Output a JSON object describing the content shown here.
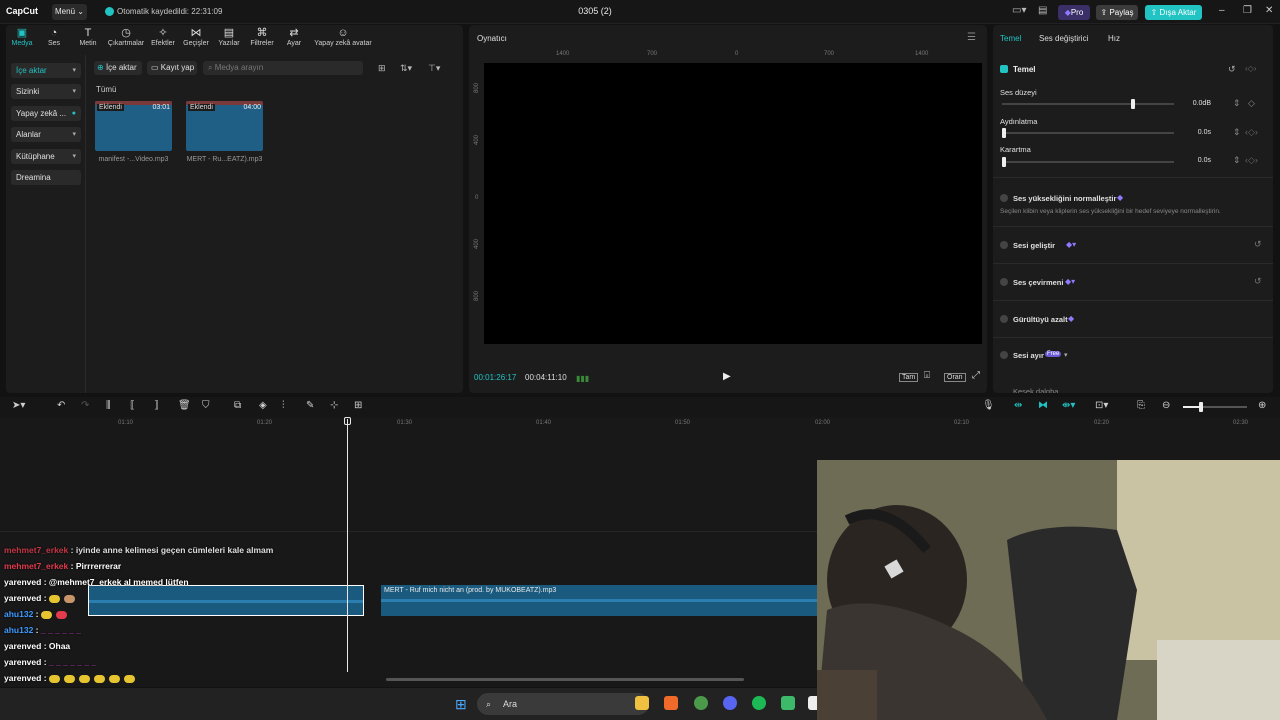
{
  "titlebar": {
    "logo": "CapCut",
    "menu_label": "Menü",
    "autosave_text": "Otomatik kaydedildi: 22:31:09",
    "project_title": "0305 (2)",
    "pro_label": "Pro",
    "share_label": "Paylaş",
    "export_label": "Dışa Aktar"
  },
  "media_panel": {
    "tabs": [
      {
        "label": "Medya",
        "icon": "media-icon"
      },
      {
        "label": "Ses",
        "icon": "audio-icon"
      },
      {
        "label": "Metin",
        "icon": "text-icon"
      },
      {
        "label": "Çıkartmalar",
        "icon": "sticker-icon"
      },
      {
        "label": "Efektler",
        "icon": "effects-icon"
      },
      {
        "label": "Geçişler",
        "icon": "transitions-icon"
      },
      {
        "label": "Yazılar",
        "icon": "captions-icon"
      },
      {
        "label": "Filtreler",
        "icon": "filters-icon"
      },
      {
        "label": "Ayar",
        "icon": "adjust-icon"
      },
      {
        "label": "Yapay zekâ avatar",
        "icon": "ai-avatar-icon"
      }
    ],
    "sidebar": [
      {
        "label": "İçe aktar"
      },
      {
        "label": "Sizinki"
      },
      {
        "label": "Yapay zekâ ..."
      },
      {
        "label": "Alanlar"
      },
      {
        "label": "Kütüphane"
      },
      {
        "label": "Dreamina"
      }
    ],
    "import_button": "İçe aktar",
    "record_button": "Kayıt yap",
    "search_placeholder": "Medya arayın",
    "filter_all": "Tümü",
    "clips": [
      {
        "tag": "Eklendi",
        "duration": "03:01",
        "name": "manifest -...Video.mp3"
      },
      {
        "tag": "Eklendi",
        "duration": "04:00",
        "name": "MERT - Ru...EATZ).mp3"
      }
    ]
  },
  "player": {
    "title": "Oynatıcı",
    "ruler_h": [
      "1400",
      "700",
      "0",
      "700",
      "1400"
    ],
    "ruler_v": [
      "800",
      "400",
      "0",
      "400",
      "800"
    ],
    "current_time": "00:01:26:17",
    "total_time": "00:04:11:10",
    "full_label": "Tam",
    "ratio_label": "Oran"
  },
  "properties": {
    "tabs": [
      "Temel",
      "Ses değiştirici",
      "Hız"
    ],
    "section_title": "Temel",
    "volume_label": "Ses düzeyi",
    "volume_value": "0.0dB",
    "volume_level": 0.75,
    "fade_in_label": "Aydınlatma",
    "fade_in_value": "0.0s",
    "fade_out_label": "Karartma",
    "fade_out_value": "0.0s",
    "normalize_label": "Ses yüksekliğini normalleştir",
    "normalize_desc": "Seçilen klibin veya kliplerin ses yüksekliğini bir hedef seviyeye normalleştirin.",
    "enhance_label": "Sesi geliştir",
    "translate_label": "Ses çevirmeni",
    "denoise_label": "Gürültüyü azalt",
    "separate_label": "Sesi ayır",
    "free_badge": "Free",
    "cut_label": "Kesek dalgba"
  },
  "timeline": {
    "ruler": [
      "01:10",
      "01:20",
      "01:30",
      "01:40",
      "01:50",
      "02:00",
      "02:10",
      "02:20",
      "02:30"
    ],
    "track2_label": "MERT - Ruf mich nicht an (prod. by MUKOBEATZ).mp3"
  },
  "chat": [
    {
      "user": "mehmet7_erkek",
      "msg": "iyinde anne kelimesi geçen cümleleri kale almam",
      "color": "red"
    },
    {
      "user": "mehmet7_erkek",
      "msg": "Pirrrerrerar",
      "color": "red"
    },
    {
      "user": "yarenved",
      "msg": "@mehmet7_erkek al memed lütfen",
      "color": "white"
    },
    {
      "user": "yarenved",
      "msg": "",
      "color": "white"
    },
    {
      "user": "ahu132",
      "msg": "",
      "color": "blue"
    },
    {
      "user": "ahu132",
      "msg": "",
      "color": "blue"
    },
    {
      "user": "yarenved",
      "msg": "Ohaa",
      "color": "white"
    },
    {
      "user": "yarenved",
      "msg": "",
      "color": "white"
    },
    {
      "user": "yarenved",
      "msg": "",
      "color": "white"
    },
    {
      "user": "yarenved",
      "msg": "",
      "color": "white"
    },
    {
      "user": "ahu132",
      "msg": "",
      "color": "blue"
    }
  ],
  "taskbar": {
    "search_label": "Ara"
  },
  "colors": {
    "accent": "#22c3c3",
    "track": "#1a5a7e",
    "pro": "#8d7bff"
  }
}
